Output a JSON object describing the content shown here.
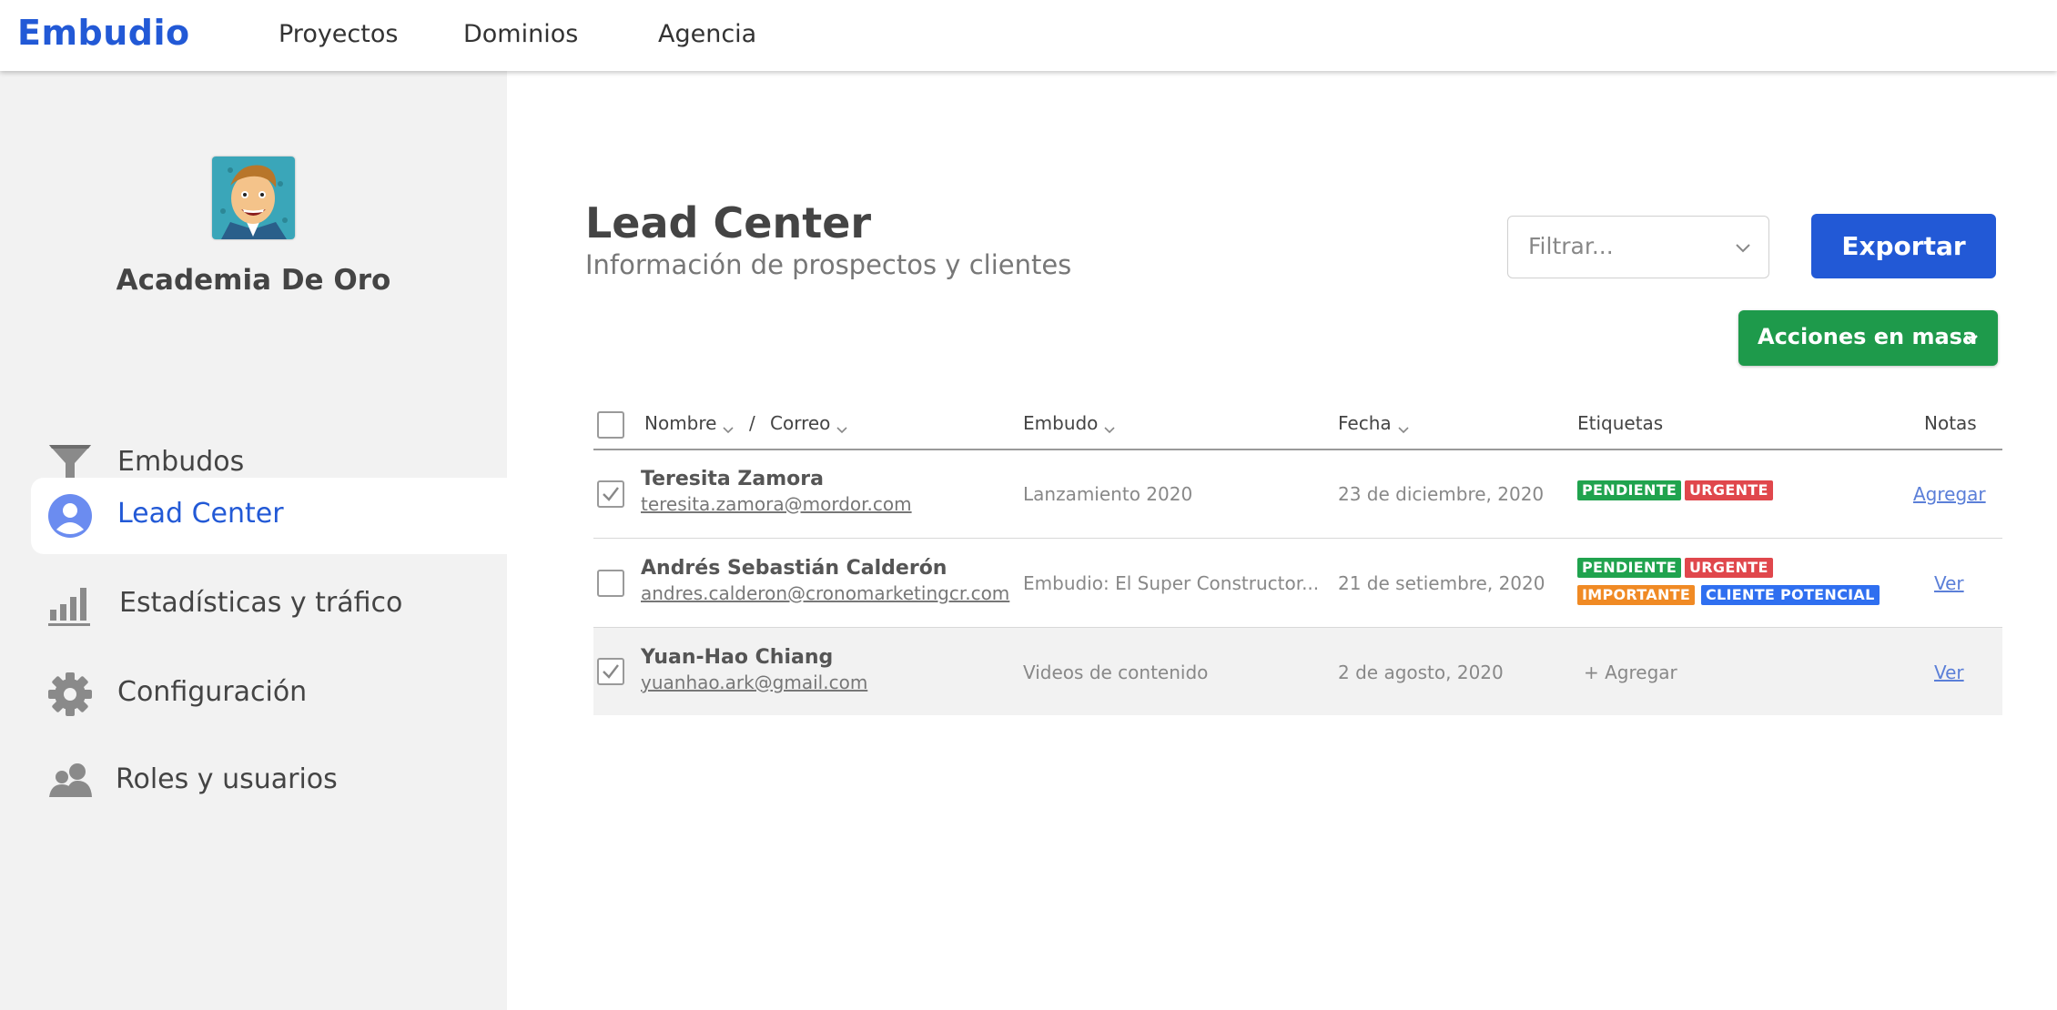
{
  "app": {
    "logo": "Embudio"
  },
  "topnav": {
    "items": [
      "Proyectos",
      "Dominios",
      "Agencia"
    ]
  },
  "sidebar": {
    "org_name": "Academia De Oro",
    "items": [
      {
        "label": "Embudos",
        "icon": "funnel-icon"
      },
      {
        "label": "Lead Center",
        "icon": "user-circle-icon",
        "active": true
      },
      {
        "label": "Estadísticas y tráfico",
        "icon": "bar-chart-icon"
      },
      {
        "label": "Configuración",
        "icon": "gear-icon"
      },
      {
        "label": "Roles y usuarios",
        "icon": "users-icon"
      }
    ]
  },
  "header": {
    "title": "Lead Center",
    "subtitle": "Información de prospectos y clientes",
    "filter_placeholder": "Filtrar...",
    "export_label": "Exportar",
    "mass_actions_label": "Acciones en masa"
  },
  "table": {
    "columns": {
      "name": "Nombre",
      "separator": "/",
      "email": "Correo",
      "funnel": "Embudo",
      "date": "Fecha",
      "tags": "Etiquetas",
      "notes": "Notas"
    },
    "rows": [
      {
        "checked": true,
        "name": "Teresita Zamora",
        "email": "teresita.zamora@mordor.com",
        "funnel": "Lanzamiento 2020",
        "date": "23 de diciembre, 2020",
        "tags": [
          "PENDIENTE",
          "URGENTE"
        ],
        "note": "Agregar"
      },
      {
        "checked": false,
        "name": "Andrés Sebastián Calderón",
        "email": "andres.calderon@cronomarketingcr.com",
        "funnel": "Embudio: El Super Constructor...",
        "date": "21 de setiembre, 2020",
        "tags": [
          "PENDIENTE",
          "URGENTE",
          "IMPORTANTE",
          "CLIENTE POTENCIAL"
        ],
        "note": "Ver"
      },
      {
        "checked": true,
        "name": "Yuan-Hao Chiang",
        "email": "yuanhao.ark@gmail.com",
        "funnel": "Videos de contenido",
        "date": "2 de agosto, 2020",
        "add_tag_label": "+ Agregar",
        "note": "Ver"
      }
    ]
  },
  "colors": {
    "brand": "#2259d6",
    "success": "#1e9a4b",
    "tag_pendiente": "#20a34e",
    "tag_urgente": "#e0474c",
    "tag_importante": "#f08a24",
    "tag_cliente_potencial": "#2f6ff0"
  }
}
